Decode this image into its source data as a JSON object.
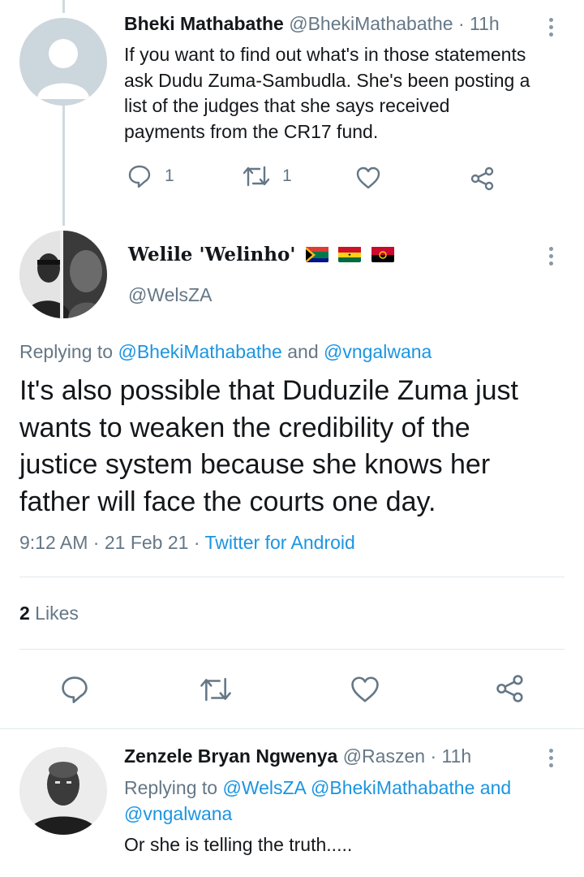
{
  "tweet1": {
    "display_name": "Bheki Mathabathe",
    "handle": "@BhekiMathabathe",
    "separator": "·",
    "time": "11h",
    "lines": [
      "If you want to find out what's in those statements",
      "ask Dudu Zuma-Sambudla. She's been posting a",
      "list of the judges that she says received",
      "payments from the CR17 fund."
    ],
    "reply_count": "1",
    "retweet_count": "1"
  },
  "main": {
    "display_name": "Welile 'Welinho'",
    "handle": "@WelsZA",
    "flags": [
      "south-africa",
      "ghana",
      "angola"
    ],
    "replying_prefix": "Replying to ",
    "replying_user1": "@BhekiMathabathe",
    "replying_and": " and ",
    "replying_user2": "@vngalwana",
    "lines": [
      "It's also possible that Duduzile Zuma just",
      "wants to weaken the credibility of the",
      "justice system because she knows her",
      "father will face the courts one day."
    ],
    "time": "9:12 AM",
    "sep1": " · ",
    "date": "21 Feb 21",
    "sep2": " · ",
    "source": "Twitter for Android",
    "likes_count": "2",
    "likes_label": " Likes"
  },
  "reply": {
    "display_name": "Zenzele Bryan Ngwenya",
    "handle": "@Raszen",
    "separator": "·",
    "time": "11h",
    "replying_prefix": "Replying to ",
    "replying_user1": "@WelsZA",
    "replying_user2": "@BhekiMathabathe",
    "replying_and": " and",
    "replying_user3": "@vngalwana",
    "text": "Or she is telling the truth....."
  },
  "colors": {
    "accent": "#1b95e0",
    "muted": "#657786",
    "divider": "#e1e8ed"
  }
}
